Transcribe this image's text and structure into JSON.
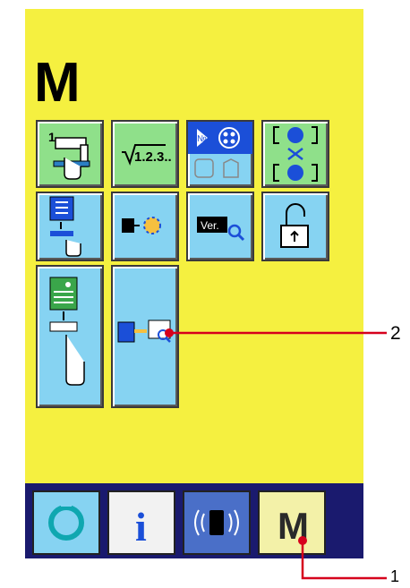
{
  "screen": {
    "title": "M",
    "colors": {
      "background": "#f5f040",
      "green_key": "#8fe08a",
      "blue_key": "#86d3f2",
      "bottom_bar": "#1a1a6e"
    }
  },
  "keys": [
    {
      "name": "register-number-key",
      "icon": "sewing-machine-hand-icon",
      "number_badge": "1"
    },
    {
      "name": "counter-key",
      "icon": "counter-icon",
      "text": "1.2.3.."
    },
    {
      "name": "pattern-select-key",
      "icon": "no-pattern-icon",
      "badge": "№"
    },
    {
      "name": "data-convert-key",
      "icon": "data-exchange-icon"
    },
    {
      "name": "memory-switch-key",
      "icon": "memory-download-icon"
    },
    {
      "name": "bobbin-winder-key",
      "icon": "bobbin-icon"
    },
    {
      "name": "version-key",
      "icon": "version-search-icon",
      "text": "Ver."
    },
    {
      "name": "keylock-key",
      "icon": "padlock-open-icon"
    },
    {
      "name": "program-rewrite-key",
      "icon": "pcb-download-icon"
    },
    {
      "name": "data-check-key",
      "icon": "communication-check-icon"
    }
  ],
  "bottom_bar": {
    "ready_icon": "reset-ring-icon",
    "info_label": "i",
    "comm_icon": "communication-icon",
    "mode_label": "M"
  },
  "callouts": {
    "one": "1",
    "two": "2"
  }
}
